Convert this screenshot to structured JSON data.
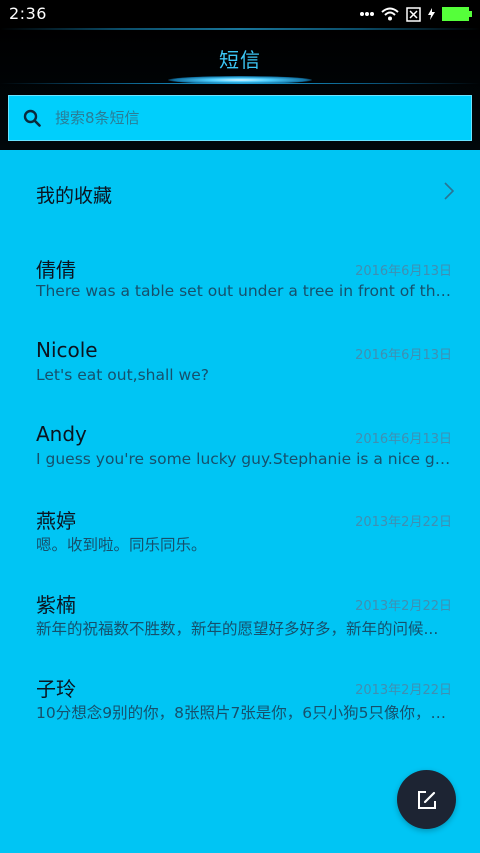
{
  "status_bar": {
    "time": "2:36",
    "icons": [
      "more-dots-icon",
      "wifi-icon",
      "sim-none-icon",
      "charging-icon",
      "battery-icon"
    ]
  },
  "header": {
    "title": "短信"
  },
  "search": {
    "placeholder": "搜索8条短信",
    "icon": "search-icon"
  },
  "favorites": {
    "label": "我的收藏",
    "icon": "chevron-right-icon"
  },
  "messages": [
    {
      "name": "倩倩",
      "date": "2016年6月13日",
      "preview": "There was a table set out under a tree in front of the house..."
    },
    {
      "name": "Nicole",
      "date": "2016年6月13日",
      "preview": "Let's eat out,shall we?"
    },
    {
      "name": "Andy",
      "date": "2016年6月13日",
      "preview": "I guess you're some lucky guy.Stephanie is a nice girl."
    },
    {
      "name": "燕婷",
      "date": "2013年2月22日",
      "preview": "嗯。收到啦。同乐同乐。"
    },
    {
      "name": "紫楠",
      "date": "2013年2月22日",
      "preview": "新年的祝福数不胜数，新年的愿望好多好多，新年的问候..."
    },
    {
      "name": "子玲",
      "date": "2013年2月22日",
      "preview": "10分想念9别的你，8张照片7张是你，6只小狗5只像你，4..."
    }
  ],
  "fab": {
    "icon": "compose-icon"
  },
  "colors": {
    "content_bg": "#00c5f4",
    "search_bg": "#00cffc",
    "title": "#3cc7f5",
    "fab_bg": "#1d2433"
  }
}
